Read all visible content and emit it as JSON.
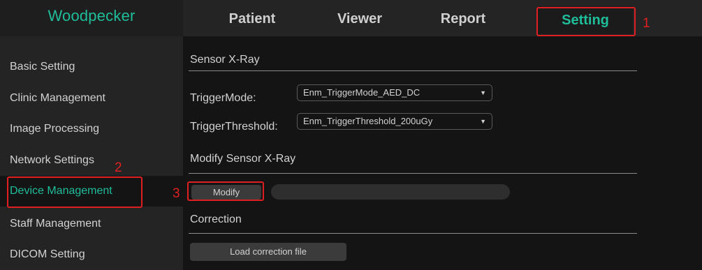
{
  "app": {
    "logo": "Woodpecker"
  },
  "nav": {
    "tabs": [
      {
        "label": "Patient"
      },
      {
        "label": "Viewer"
      },
      {
        "label": "Report"
      },
      {
        "label": "Setting",
        "active": true
      }
    ]
  },
  "annotations": {
    "step1": "1",
    "step2": "2",
    "step3": "3"
  },
  "sidebar": {
    "items": [
      {
        "label": "Basic Setting"
      },
      {
        "label": "Clinic Management"
      },
      {
        "label": "Image Processing"
      },
      {
        "label": "Network Settings"
      },
      {
        "label": "Device Management",
        "active": true
      },
      {
        "label": "Staff Management"
      },
      {
        "label": "DICOM Setting"
      }
    ]
  },
  "main": {
    "sensor_section": {
      "title": "Sensor X-Ray"
    },
    "trigger_mode": {
      "label": "TriggerMode:",
      "value": "Enm_TriggerMode_AED_DC"
    },
    "trigger_threshold": {
      "label": "TriggerThreshold:",
      "value": "Enm_TriggerThreshold_200uGy"
    },
    "modify_section": {
      "title": "Modify Sensor X-Ray",
      "button": "Modify",
      "progress": 0
    },
    "correction_section": {
      "title": "Correction",
      "button": "Load correction file"
    }
  },
  "colors": {
    "accent": "#1fbd9a",
    "annotation": "#e02020",
    "background": "#141414",
    "panel": "#242424"
  }
}
